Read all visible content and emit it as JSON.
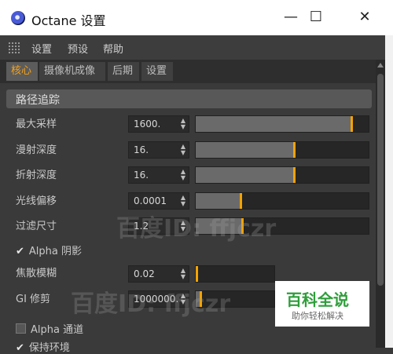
{
  "window": {
    "title": "Octane 设置",
    "minimize": "—",
    "maximize": "☐",
    "close": "✕"
  },
  "menu": [
    "设置",
    "预设",
    "帮助"
  ],
  "tabs": [
    {
      "label": "核心",
      "active": true
    },
    {
      "label": "摄像机成像",
      "active": false
    },
    {
      "label": "后期",
      "active": false
    },
    {
      "label": "设置",
      "active": false
    }
  ],
  "section": {
    "title": "路径追踪"
  },
  "rows": {
    "max_samples": {
      "label": "最大采样",
      "value": "1600.",
      "level": 0.9
    },
    "diffuse_depth": {
      "label": "漫射深度",
      "value": "16.",
      "level": 0.57
    },
    "refract_depth": {
      "label": "折射深度",
      "value": "16.",
      "level": 0.57
    },
    "ray_epsilon": {
      "label": "光线偏移",
      "value": "0.0001",
      "level": 0.26
    },
    "filter_size": {
      "label": "过滤尺寸",
      "value": "1.2",
      "level": 0.27
    },
    "alpha_shadow": {
      "label": "Alpha 阴影",
      "checked": true
    },
    "caustic_blur": {
      "label": "焦散模糊",
      "value": "0.02",
      "level": 0.01
    },
    "gi_clamp": {
      "label": "GI 修剪",
      "value": "1000000.",
      "level": 0.06
    },
    "alpha_channel": {
      "label": "Alpha 通道",
      "checked": false
    },
    "keep_env": {
      "label": "保持环境",
      "checked": true
    }
  },
  "watermark": {
    "text1": "百度ID: ffjczr",
    "text2": "百度ID: ffjczr"
  },
  "logo": {
    "title": "百科全说",
    "subtitle": "助你轻松解决"
  },
  "colors": {
    "accent": "#f4a300",
    "tab_active_text": "#f6a21a",
    "logo_green": "#2e9e3a"
  }
}
